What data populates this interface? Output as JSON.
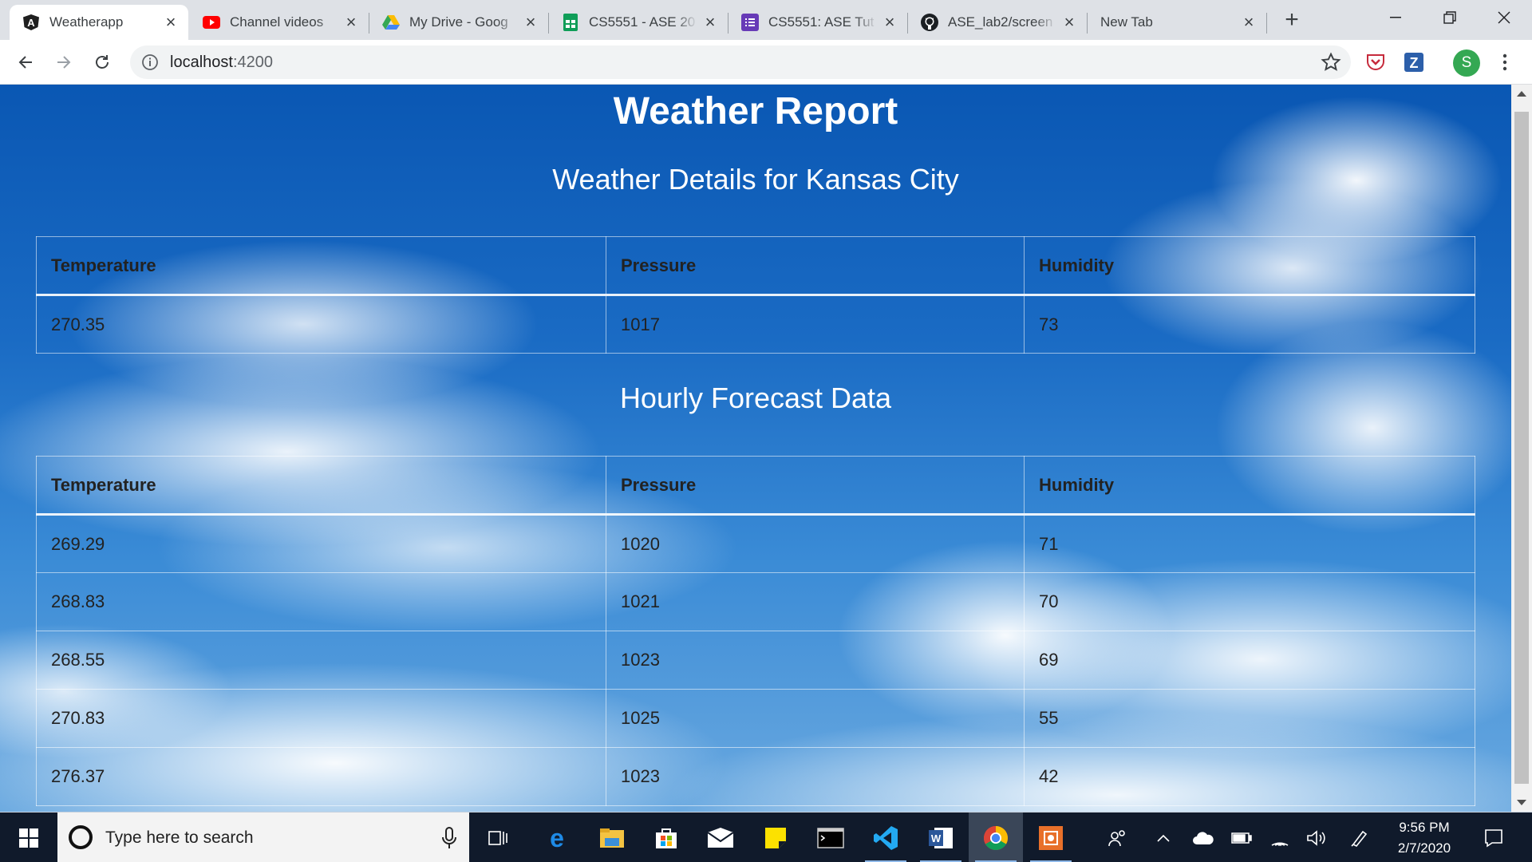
{
  "browser": {
    "tabs": [
      {
        "title": "Weatherapp",
        "icon": "angular-icon",
        "active": true
      },
      {
        "title": "Channel videos",
        "icon": "youtube-icon"
      },
      {
        "title": "My Drive - Goog",
        "icon": "google-drive-icon"
      },
      {
        "title": "CS5551 - ASE 20",
        "icon": "google-sheets-icon"
      },
      {
        "title": "CS5551: ASE Tut",
        "icon": "google-forms-icon"
      },
      {
        "title": "ASE_lab2/screen",
        "icon": "github-icon"
      },
      {
        "title": "New Tab",
        "icon": ""
      }
    ],
    "address": {
      "host": "localhost",
      "port": ":4200"
    },
    "profile_initial": "S",
    "colors": {
      "profile": "#34a853",
      "accent": "#1a73e8"
    }
  },
  "page": {
    "title": "Weather Report",
    "subtitle": "Weather Details for Kansas City",
    "current_table": {
      "headers": [
        "Temperature",
        "Pressure",
        "Humidity"
      ],
      "rows": [
        [
          "270.35",
          "1017",
          "73"
        ]
      ]
    },
    "forecast_heading": "Hourly Forecast Data",
    "forecast_table": {
      "headers": [
        "Temperature",
        "Pressure",
        "Humidity"
      ],
      "rows": [
        [
          "269.29",
          "1020",
          "71"
        ],
        [
          "268.83",
          "1021",
          "70"
        ],
        [
          "268.55",
          "1023",
          "69"
        ],
        [
          "270.83",
          "1025",
          "55"
        ],
        [
          "276.37",
          "1023",
          "42"
        ]
      ]
    }
  },
  "taskbar": {
    "search_placeholder": "Type here to search",
    "apps": [
      "task-view-icon",
      "edge-icon",
      "file-explorer-icon",
      "store-icon",
      "mail-icon",
      "sticky-notes-icon",
      "terminal-icon",
      "vscode-icon",
      "word-icon",
      "chrome-icon",
      "snip-icon"
    ],
    "time": "9:56 PM",
    "date": "2/7/2020"
  }
}
